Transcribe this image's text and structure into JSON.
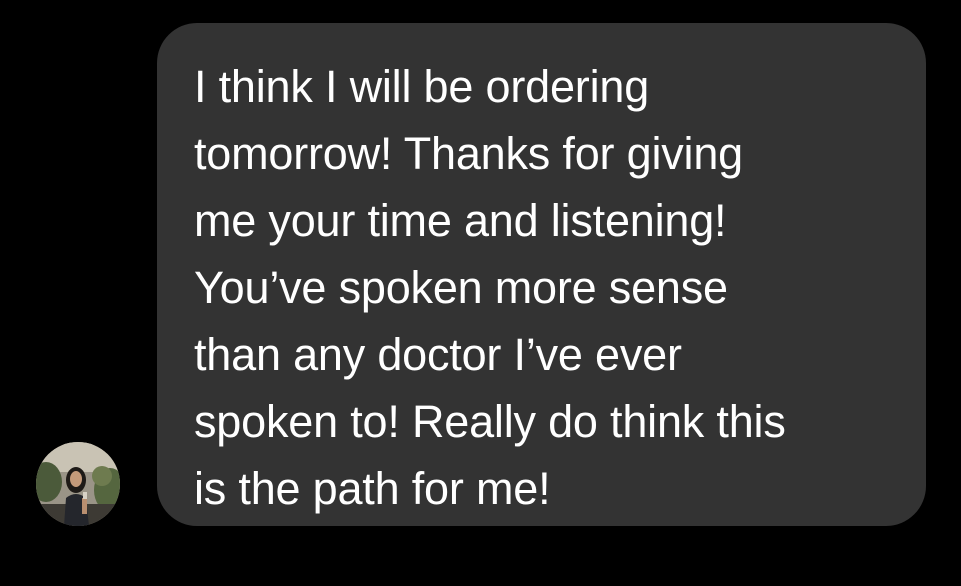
{
  "conversation": {
    "message": {
      "text": "I think I will be ordering\ntomorrow! Thanks for giving\nme your time and listening!\nYou’ve spoken more sense\nthan any doctor I’ve ever\nspoken to! Really do think this\nis the path for me!",
      "bubble_color": "#333333",
      "text_color": "#ffffff"
    },
    "sender": {
      "avatar_icon": "profile-photo-avatar"
    },
    "background_color": "#000000"
  }
}
